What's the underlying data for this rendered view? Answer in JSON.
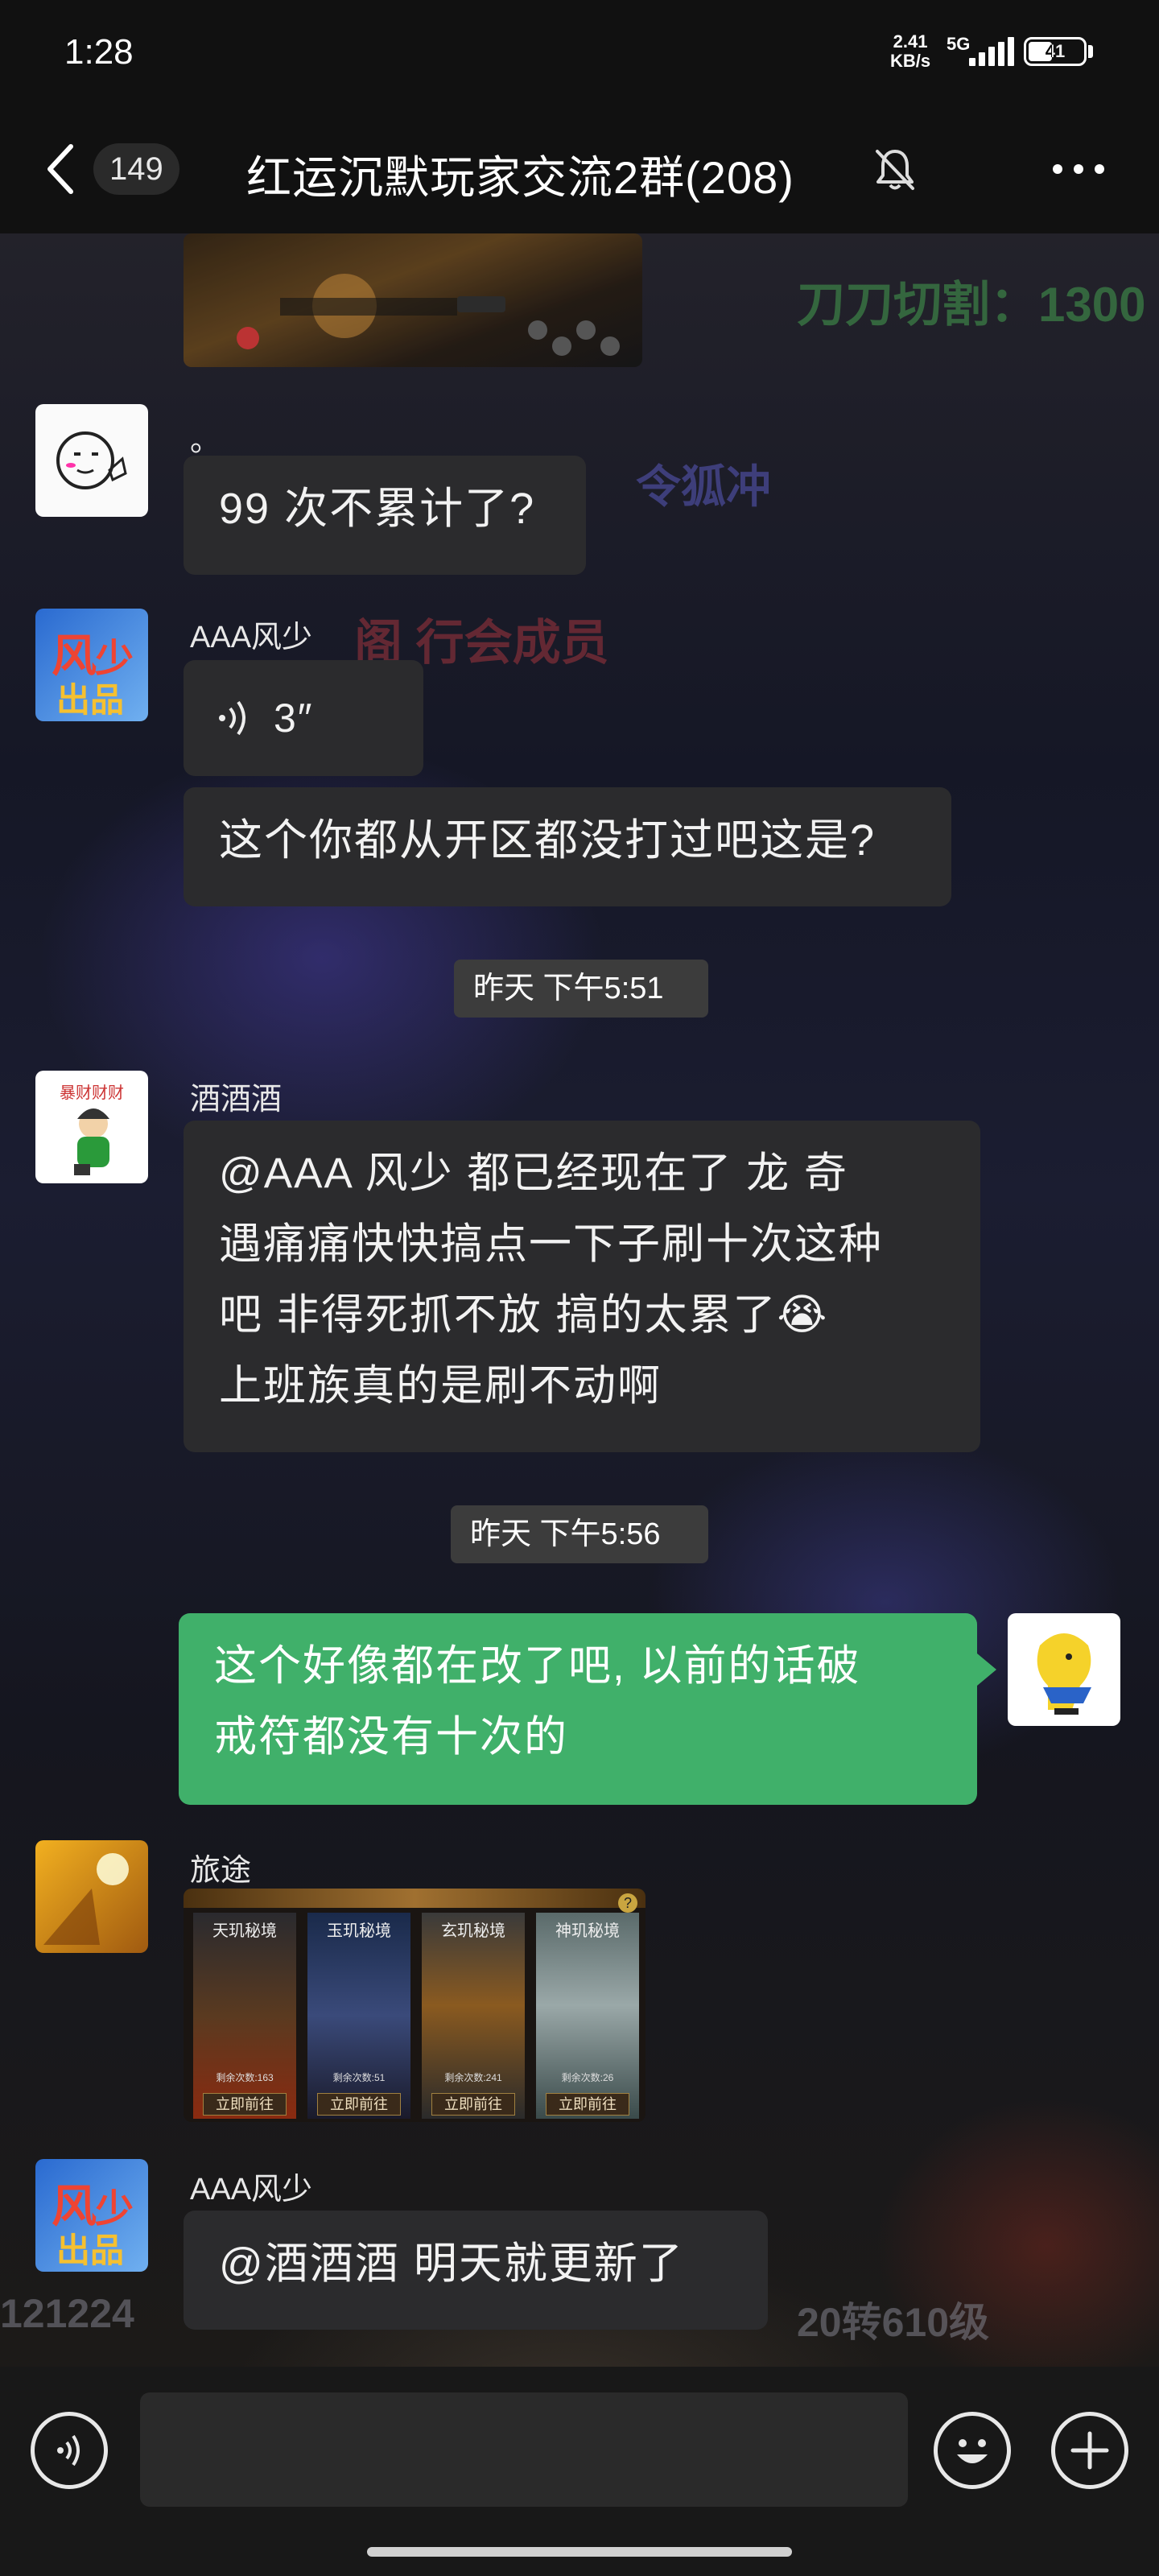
{
  "status_bar": {
    "time": "1:28",
    "network_speed_value": "2.41",
    "network_speed_unit": "KB/s",
    "network_type": "5G",
    "battery": "41"
  },
  "header": {
    "unread_count": "149",
    "title": "红运沉默玩家交流2群(208)",
    "icons": [
      "back-arrow-icon",
      "mute-bell-icon",
      "more-icon"
    ]
  },
  "messages": [
    {
      "type": "image",
      "sender": "",
      "description_icon": "game-screenshot"
    },
    {
      "type": "text",
      "sender": "。",
      "text": "99 次不累计了?"
    },
    {
      "type": "voice",
      "sender": "AAA风少",
      "duration": "3″"
    },
    {
      "type": "text",
      "sender": "AAA风少",
      "text": "这个你都从开区都没打过吧这是?"
    },
    {
      "type": "timestamp",
      "text": "昨天 下午5:51"
    },
    {
      "type": "text",
      "sender": "酒酒酒",
      "lines": [
        "@AAA 风少  都已经现在了  龙  奇",
        "遇痛痛快快搞点一下子刷十次这种",
        "吧  非得死抓不放   搞的太累了😭",
        "上班族真的是刷不动啊"
      ]
    },
    {
      "type": "timestamp",
      "text": "昨天 下午5:56"
    },
    {
      "type": "text",
      "sender": "self",
      "lines": [
        "这个好像都在改了吧, 以前的话破",
        "戒符都没有十次的"
      ]
    },
    {
      "type": "image",
      "sender": "旅途",
      "cards": [
        {
          "name": "天玑秘境",
          "count": "剩余次数:163",
          "button": "立即前往"
        },
        {
          "name": "玉玑秘境",
          "count": "剩余次数:51",
          "button": "立即前往"
        },
        {
          "name": "玄玑秘境",
          "count": "剩余次数:241",
          "button": "立即前往"
        },
        {
          "name": "神玑秘境",
          "count": "剩余次数:26",
          "button": "立即前往"
        }
      ]
    },
    {
      "type": "text",
      "sender": "AAA风少",
      "text": "@酒酒酒  明天就更新了"
    }
  ],
  "background_text": {
    "t1": "刀刀切割：1300",
    "t2": "令狐冲",
    "t3": "阁 行会成员",
    "t4": "121224",
    "t5": "20转610级"
  },
  "input_bar": {
    "icons": [
      "voice-input-icon",
      "emoji-icon",
      "plus-icon"
    ],
    "placeholder": ""
  },
  "colors": {
    "self_bubble": "#40b06a",
    "other_bubble": "#2b2b2d",
    "header_bg": "#111111"
  }
}
